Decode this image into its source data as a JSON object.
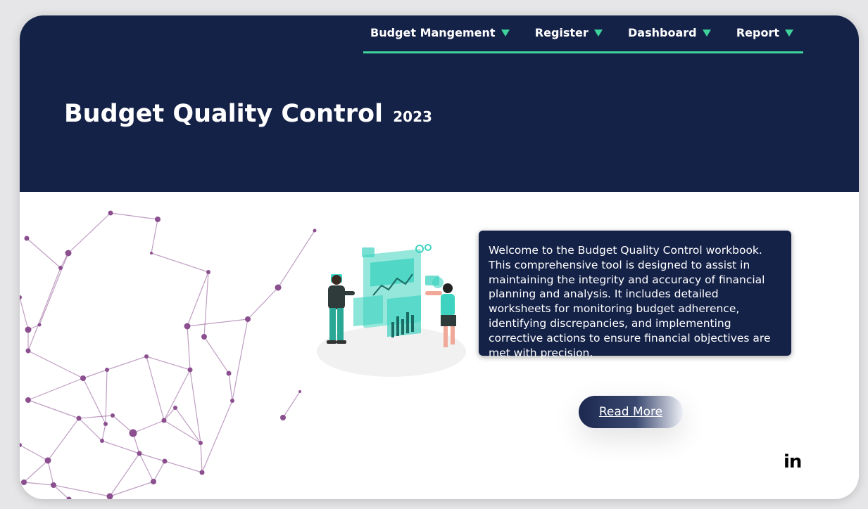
{
  "nav": {
    "items": [
      {
        "label": "Budget Mangement"
      },
      {
        "label": "Register"
      },
      {
        "label": "Dashboard"
      },
      {
        "label": "Report"
      }
    ]
  },
  "header": {
    "title": "Budget Quality Control",
    "year": "2023"
  },
  "intro": {
    "text": "Welcome to the Budget Quality Control workbook. This comprehensive tool is designed to assist in maintaining the integrity and accuracy of financial planning and analysis. It includes detailed worksheets for monitoring budget adherence, identifying discrepancies, and implementing corrective actions to ensure financial objectives are met with precision."
  },
  "cta": {
    "read_more": "Read More"
  },
  "social": {
    "linkedin_label": "in"
  },
  "colors": {
    "header_bg": "#152248",
    "accent": "#3ed39b",
    "network": "#8b4f8f",
    "illustration": "#3ed3c0"
  }
}
